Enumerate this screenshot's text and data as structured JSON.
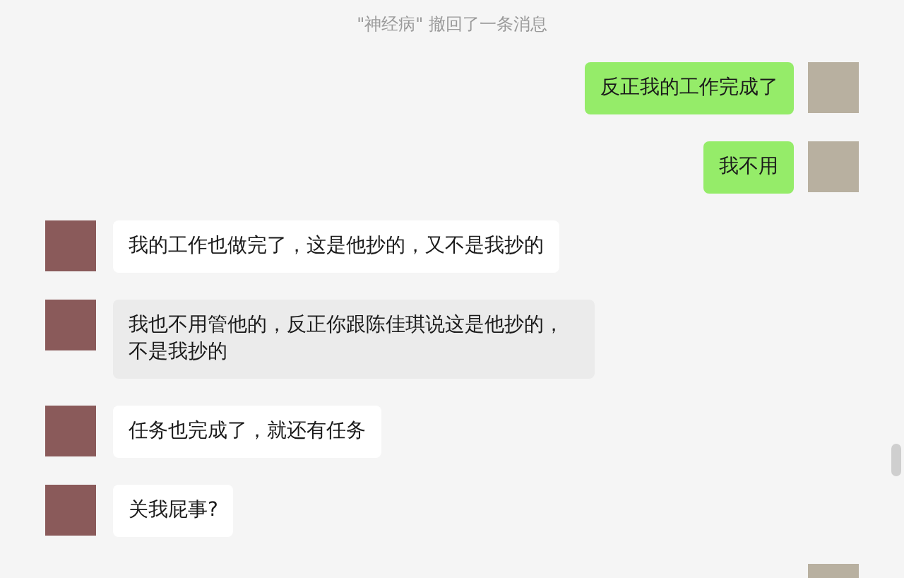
{
  "notice": "\"神经病\" 撤回了一条消息",
  "messages": [
    {
      "kind": "sent",
      "text": "反正我的工作完成了",
      "selected": false
    },
    {
      "kind": "sent",
      "text": "我不用",
      "selected": false
    },
    {
      "kind": "received",
      "text": "我的工作也做完了，这是他抄的，又不是我抄的",
      "selected": false
    },
    {
      "kind": "received",
      "text": "我也不用管他的，反正你跟陈佳琪说这是他抄的，不是我抄的",
      "selected": true
    },
    {
      "kind": "received",
      "text": "任务也完成了，就还有任务",
      "selected": false
    },
    {
      "kind": "received",
      "text": "关我屁事?",
      "selected": false
    }
  ]
}
